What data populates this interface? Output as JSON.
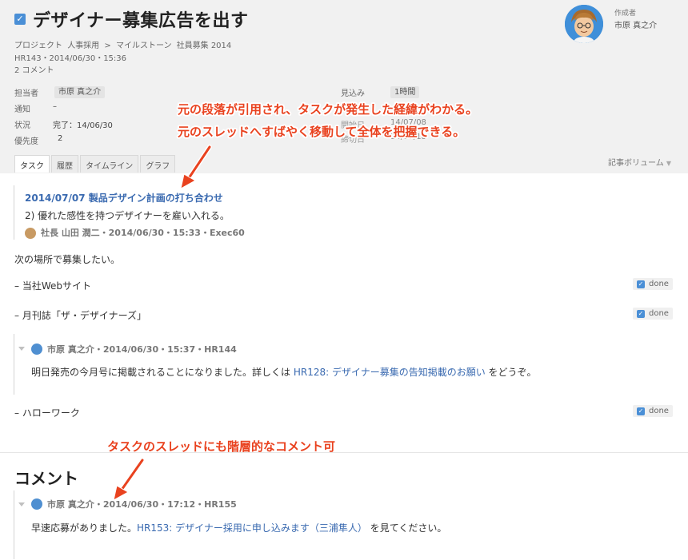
{
  "task": {
    "title": "デザイナー募集広告を出す",
    "breadcrumb": [
      "プロジェクト",
      "人事採用",
      ">",
      "マイルストーン",
      "社員募集 2014"
    ],
    "id_line": "HR143・2014/06/30・15:36",
    "comments_count": "2 コメント"
  },
  "author": {
    "label": "作成者",
    "name": "市原 真之介"
  },
  "props": {
    "assignee_label": "担当者",
    "assignee_value": "市原 真之介",
    "notify_label": "通知",
    "notify_value": "–",
    "status_label": "状況",
    "status_value": "完了：14/06/30",
    "priority_label": "優先度",
    "priority_value": "2",
    "estimate_label": "見込み",
    "estimate_value": "1時間",
    "start_partial": "開始日",
    "start_partial_value": "14/07/08",
    "due_partial": "締切日",
    "due_partial_value": "14/07/18"
  },
  "tabs": [
    "タスク",
    "履歴",
    "タイムライン",
    "グラフ"
  ],
  "volume_label": "記事ボリューム",
  "annotations": {
    "line1": "元の段落が引用され、タスクが発生した経緯がわかる。",
    "line2": "元のスレッドへすばやく移動して全体を把握できる。",
    "line3": "タスクのスレッドにも階層的なコメント可"
  },
  "quote": {
    "title": "2014/07/07 製品デザイン計画の打ち合わせ",
    "text": "2) 優れた感性を持つデザイナーを雇い入れる。",
    "meta": "社長 山田 潤二・2014/06/30・15:33・Exec60"
  },
  "body": {
    "intro": "次の場所で募集したい。",
    "item1": "– 当社Webサイト",
    "item2": "– 月刊誌「ザ・デザイナーズ」",
    "item3": "– ハローワーク",
    "done_label": "done"
  },
  "thread1": {
    "meta": "市原 真之介・2014/06/30・15:37・HR144",
    "text_before": "明日発売の今月号に掲載されることになりました。詳しくは ",
    "link": "HR128: デザイナー募集の告知掲載のお願い",
    "text_after": " をどうぞ。"
  },
  "comments_section": {
    "title": "コメント",
    "meta": "市原 真之介・2014/06/30・17:12・HR155",
    "text_before": "早速応募がありました。",
    "link": "HR153: デザイナー採用に申し込みます（三浦隼人）",
    "text_after": " を見てください。"
  },
  "colors": {
    "accent": "#4a8fd6",
    "link": "#3a6ab0",
    "annotation": "#e9421f"
  }
}
